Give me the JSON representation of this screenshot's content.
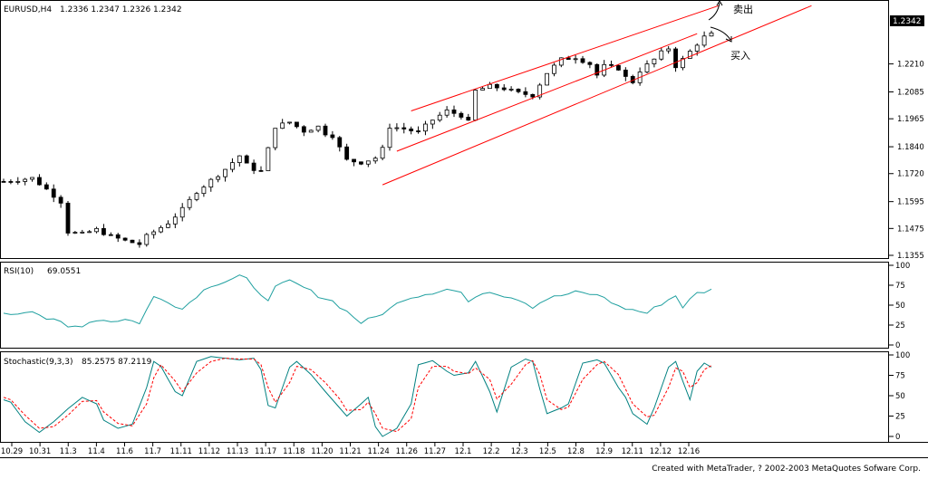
{
  "chart_data": [
    {
      "type": "candlestick",
      "symbol_label": "EURUSD,H4",
      "ohlc_label": "1.2336 1.2347 1.2326 1.2342",
      "last_price_label": "1.2342",
      "ylim": [
        1.1355,
        1.2455
      ],
      "y_ticks": [
        "1.2210",
        "1.2085",
        "1.1965",
        "1.1840",
        "1.1720",
        "1.1595",
        "1.1475",
        "1.1355"
      ],
      "x_ticks": [
        "10.29",
        "10.31",
        "11.3",
        "11.4",
        "11.6",
        "11.7",
        "11.11",
        "11.12",
        "11.13",
        "11.17",
        "11.18",
        "11.20",
        "11.21",
        "11.24",
        "11.26",
        "11.27",
        "12.1",
        "12.2",
        "12.3",
        "12.5",
        "12.8",
        "12.9",
        "12.11",
        "12.12",
        "12.16"
      ],
      "close_path": [
        [
          0,
          1.1685
        ],
        [
          4,
          1.17
        ],
        [
          6,
          1.165
        ],
        [
          8,
          1.1595
        ],
        [
          9,
          1.146
        ],
        [
          11,
          1.145
        ],
        [
          13,
          1.147
        ],
        [
          15,
          1.144
        ],
        [
          17,
          1.142
        ],
        [
          19,
          1.1405
        ],
        [
          20,
          1.144
        ],
        [
          22,
          1.148
        ],
        [
          23,
          1.15
        ],
        [
          25,
          1.156
        ],
        [
          27,
          1.164
        ],
        [
          29,
          1.169
        ],
        [
          31,
          1.174
        ],
        [
          33,
          1.18
        ],
        [
          34,
          1.176
        ],
        [
          35,
          1.174
        ],
        [
          36,
          1.173
        ],
        [
          38,
          1.193
        ],
        [
          40,
          1.195
        ],
        [
          42,
          1.191
        ],
        [
          44,
          1.193
        ],
        [
          45,
          1.19
        ],
        [
          46,
          1.189
        ],
        [
          48,
          1.178
        ],
        [
          50,
          1.177
        ],
        [
          52,
          1.179
        ],
        [
          53,
          1.183
        ],
        [
          54,
          1.193
        ],
        [
          56,
          1.192
        ],
        [
          58,
          1.1905
        ],
        [
          60,
          1.196
        ],
        [
          62,
          1.2
        ],
        [
          64,
          1.198
        ],
        [
          65,
          1.195
        ],
        [
          66,
          1.209
        ],
        [
          68,
          1.211
        ],
        [
          70,
          1.21
        ],
        [
          72,
          1.208
        ],
        [
          74,
          1.207
        ],
        [
          76,
          1.217
        ],
        [
          78,
          1.223
        ],
        [
          80,
          1.224
        ],
        [
          82,
          1.221
        ],
        [
          83,
          1.216
        ],
        [
          84,
          1.22
        ],
        [
          86,
          1.219
        ],
        [
          87,
          1.215
        ],
        [
          88,
          1.213
        ],
        [
          89,
          1.218
        ],
        [
          91,
          1.223
        ],
        [
          92,
          1.226
        ],
        [
          93,
          1.228
        ],
        [
          94,
          1.22
        ],
        [
          95,
          1.223
        ],
        [
          97,
          1.23
        ],
        [
          98,
          1.233
        ],
        [
          99,
          1.2342
        ]
      ],
      "x_count": 100,
      "channel_lines": [
        {
          "from": [
            57,
            1.2
          ],
          "to": [
            100,
            1.247
          ]
        },
        {
          "from": [
            55,
            1.182
          ],
          "to": [
            97,
            1.2345
          ]
        },
        {
          "from": [
            53,
            1.167
          ],
          "to": [
            113,
            1.247
          ]
        }
      ],
      "annotations": [
        {
          "text": "卖出",
          "at": [
            101,
            1.2415
          ]
        },
        {
          "text": "买入",
          "at": [
            101,
            1.219
          ]
        }
      ]
    },
    {
      "type": "line",
      "label": "RSI(10)",
      "value_label": "69.0551",
      "ylim": [
        0,
        100
      ],
      "y_ticks": [
        "100",
        "75",
        "50",
        "25",
        "0"
      ],
      "series": [
        {
          "values": [
            [
              0,
              38
            ],
            [
              2,
              40
            ],
            [
              4,
              44
            ],
            [
              6,
              33
            ],
            [
              8,
              28
            ],
            [
              9,
              22
            ],
            [
              11,
              25
            ],
            [
              13,
              32
            ],
            [
              15,
              30
            ],
            [
              17,
              32
            ],
            [
              19,
              28
            ],
            [
              21,
              60
            ],
            [
              23,
              55
            ],
            [
              25,
              45
            ],
            [
              27,
              62
            ],
            [
              29,
              75
            ],
            [
              31,
              80
            ],
            [
              33,
              87
            ],
            [
              34,
              82
            ],
            [
              35,
              70
            ],
            [
              37,
              58
            ],
            [
              38,
              72
            ],
            [
              40,
              80
            ],
            [
              42,
              72
            ],
            [
              44,
              62
            ],
            [
              46,
              55
            ],
            [
              48,
              42
            ],
            [
              50,
              28
            ],
            [
              52,
              35
            ],
            [
              54,
              45
            ],
            [
              56,
              58
            ],
            [
              58,
              62
            ],
            [
              60,
              66
            ],
            [
              62,
              70
            ],
            [
              64,
              66
            ],
            [
              65,
              52
            ],
            [
              66,
              62
            ],
            [
              68,
              68
            ],
            [
              70,
              62
            ],
            [
              72,
              58
            ],
            [
              74,
              48
            ],
            [
              76,
              58
            ],
            [
              78,
              62
            ],
            [
              80,
              66
            ],
            [
              82,
              64
            ],
            [
              84,
              60
            ],
            [
              86,
              48
            ],
            [
              88,
              44
            ],
            [
              90,
              40
            ],
            [
              92,
              52
            ],
            [
              94,
              62
            ],
            [
              95,
              48
            ],
            [
              97,
              65
            ],
            [
              99,
              69
            ]
          ]
        }
      ]
    },
    {
      "type": "line",
      "label": "Stochastic(9,3,3)",
      "value_label": "85.2575  87.2119",
      "ylim": [
        0,
        100
      ],
      "y_ticks": [
        "100",
        "75",
        "50",
        "25",
        "0"
      ],
      "series": [
        {
          "color": "#008080",
          "values": [
            [
              0,
              45
            ],
            [
              1,
              42
            ],
            [
              3,
              18
            ],
            [
              5,
              5
            ],
            [
              7,
              18
            ],
            [
              9,
              34
            ],
            [
              11,
              48
            ],
            [
              13,
              40
            ],
            [
              14,
              20
            ],
            [
              16,
              10
            ],
            [
              18,
              15
            ],
            [
              20,
              60
            ],
            [
              21,
              92
            ],
            [
              22,
              86
            ],
            [
              24,
              55
            ],
            [
              25,
              50
            ],
            [
              27,
              92
            ],
            [
              29,
              98
            ],
            [
              31,
              96
            ],
            [
              33,
              94
            ],
            [
              35,
              96
            ],
            [
              36,
              82
            ],
            [
              37,
              38
            ],
            [
              38,
              35
            ],
            [
              40,
              85
            ],
            [
              41,
              92
            ],
            [
              43,
              76
            ],
            [
              45,
              55
            ],
            [
              47,
              35
            ],
            [
              48,
              25
            ],
            [
              50,
              40
            ],
            [
              51,
              48
            ],
            [
              52,
              12
            ],
            [
              53,
              0
            ],
            [
              55,
              10
            ],
            [
              57,
              40
            ],
            [
              58,
              88
            ],
            [
              60,
              93
            ],
            [
              62,
              80
            ],
            [
              63,
              75
            ],
            [
              65,
              78
            ],
            [
              66,
              92
            ],
            [
              68,
              55
            ],
            [
              69,
              30
            ],
            [
              71,
              85
            ],
            [
              73,
              95
            ],
            [
              74,
              92
            ],
            [
              75,
              58
            ],
            [
              76,
              28
            ],
            [
              78,
              35
            ],
            [
              79,
              40
            ],
            [
              81,
              90
            ],
            [
              83,
              94
            ],
            [
              84,
              90
            ],
            [
              86,
              60
            ],
            [
              87,
              48
            ],
            [
              88,
              28
            ],
            [
              90,
              15
            ],
            [
              91,
              35
            ],
            [
              93,
              85
            ],
            [
              94,
              92
            ],
            [
              95,
              68
            ],
            [
              96,
              45
            ],
            [
              97,
              80
            ],
            [
              98,
              90
            ],
            [
              99,
              85
            ]
          ]
        },
        {
          "color": "#ff0000",
          "values": [
            [
              0,
              48
            ],
            [
              1,
              45
            ],
            [
              3,
              26
            ],
            [
              5,
              10
            ],
            [
              7,
              12
            ],
            [
              9,
              26
            ],
            [
              11,
              43
            ],
            [
              13,
              44
            ],
            [
              14,
              30
            ],
            [
              16,
              16
            ],
            [
              18,
              13
            ],
            [
              20,
              40
            ],
            [
              21,
              72
            ],
            [
              22,
              88
            ],
            [
              24,
              68
            ],
            [
              25,
              55
            ],
            [
              27,
              78
            ],
            [
              29,
              92
            ],
            [
              31,
              96
            ],
            [
              33,
              95
            ],
            [
              35,
              95
            ],
            [
              36,
              88
            ],
            [
              37,
              60
            ],
            [
              38,
              42
            ],
            [
              40,
              66
            ],
            [
              41,
              86
            ],
            [
              43,
              82
            ],
            [
              45,
              66
            ],
            [
              47,
              46
            ],
            [
              48,
              32
            ],
            [
              50,
              33
            ],
            [
              51,
              42
            ],
            [
              52,
              28
            ],
            [
              53,
              10
            ],
            [
              55,
              6
            ],
            [
              57,
              22
            ],
            [
              58,
              60
            ],
            [
              60,
              86
            ],
            [
              62,
              86
            ],
            [
              63,
              80
            ],
            [
              65,
              77
            ],
            [
              66,
              84
            ],
            [
              68,
              70
            ],
            [
              69,
              46
            ],
            [
              71,
              64
            ],
            [
              73,
              88
            ],
            [
              74,
              93
            ],
            [
              75,
              76
            ],
            [
              76,
              45
            ],
            [
              78,
              33
            ],
            [
              79,
              36
            ],
            [
              81,
              70
            ],
            [
              83,
              88
            ],
            [
              84,
              92
            ],
            [
              86,
              76
            ],
            [
              87,
              58
            ],
            [
              88,
              40
            ],
            [
              90,
              24
            ],
            [
              91,
              26
            ],
            [
              93,
              60
            ],
            [
              94,
              84
            ],
            [
              95,
              80
            ],
            [
              96,
              60
            ],
            [
              97,
              66
            ],
            [
              98,
              82
            ],
            [
              99,
              87
            ]
          ]
        }
      ]
    }
  ],
  "footer_credit": "Created with MetaTrader, ? 2002-2003 MetaQuotes Sofware Corp."
}
